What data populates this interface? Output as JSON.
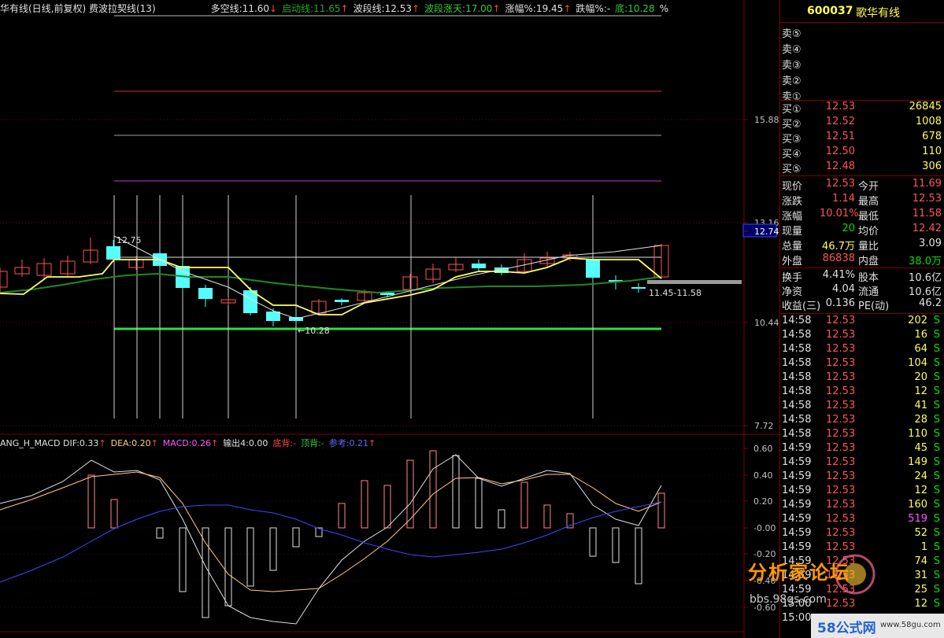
{
  "header": {
    "title": "华有线(日线,前复权) 费波拉契线(13)",
    "items": [
      {
        "label": "多空线:11.60",
        "arrow": "↓",
        "color": "#e0e0e0"
      },
      {
        "label": "启动线:11.65",
        "arrow": "↑",
        "color": "#22aa22"
      },
      {
        "label": "波段线:12.53",
        "arrow": "↑",
        "color": "#e0e0e0"
      },
      {
        "label": "波段涨天:17.00",
        "arrow": "↑",
        "color": "#33cc33"
      },
      {
        "label": "涨幅%:19.45",
        "arrow": "↑",
        "color": "#e0e0e0"
      },
      {
        "label": "跌幅%:-",
        "arrow": "",
        "color": "#e0e0e0"
      },
      {
        "label": "底:10.28",
        "arrow": "",
        "color": "#33cc33"
      },
      {
        "label": "%",
        "arrow": "",
        "color": "#e0e0e0"
      }
    ]
  },
  "price_axis": [
    "15.88",
    "13.16",
    "12.74",
    "10.44",
    "7.72"
  ],
  "annotations": {
    "high": "12.75",
    "low": "10.28",
    "range": "11.45-11.58"
  },
  "macd_header": [
    {
      "label": "ANG_H_MACD DIF:0.33",
      "arrow": "↑",
      "color": "#e0e0e0"
    },
    {
      "label": "DEA:0.20",
      "arrow": "↑",
      "color": "#ffcc88"
    },
    {
      "label": "MACD:0.26",
      "arrow": "↑",
      "color": "#ff55ff"
    },
    {
      "label": "输出4:0.00",
      "arrow": "",
      "color": "#e0e0e0"
    },
    {
      "label": "底背:-",
      "arrow": "",
      "color": "#ff4444"
    },
    {
      "label": "顶背:-",
      "arrow": "",
      "color": "#33cc33"
    },
    {
      "label": "参考:0.21",
      "arrow": "↑",
      "color": "#6666ff"
    }
  ],
  "macd_axis": [
    "0.60",
    "0.40",
    "0.20",
    "-0.00",
    "-0.20",
    "-0.40",
    "-0.60"
  ],
  "panel": {
    "code": "600037",
    "name": "歌华有线",
    "sells": [
      "卖⑤",
      "卖④",
      "卖③",
      "卖②",
      "卖①"
    ],
    "buys": [
      {
        "label": "买①",
        "price": "12.53",
        "vol": "26845"
      },
      {
        "label": "买②",
        "price": "12.52",
        "vol": "1008"
      },
      {
        "label": "买③",
        "price": "12.51",
        "vol": "678"
      },
      {
        "label": "买④",
        "price": "12.50",
        "vol": "110"
      },
      {
        "label": "买⑤",
        "price": "12.48",
        "vol": "306"
      }
    ],
    "quote": [
      {
        "l1": "现价",
        "v1": "12.53",
        "c1": "red",
        "l2": "今开",
        "v2": "11.69",
        "c2": "red"
      },
      {
        "l1": "涨跌",
        "v1": "1.14",
        "c1": "red",
        "l2": "最高",
        "v2": "12.53",
        "c2": "red"
      },
      {
        "l1": "涨幅",
        "v1": "10.01%",
        "c1": "red",
        "l2": "最低",
        "v2": "11.58",
        "c2": "red"
      },
      {
        "l1": "现量",
        "v1": "20",
        "c1": "grn",
        "l2": "均价",
        "v2": "12.42",
        "c2": "red"
      },
      {
        "l1": "总量",
        "v1": "46.7万",
        "c1": "yel",
        "l2": "量比",
        "v2": "3.09",
        "c2": "wht"
      },
      {
        "l1": "外盘",
        "v1": "86838",
        "c1": "red",
        "l2": "内盘",
        "v2": "38.0万",
        "c2": "grn"
      }
    ],
    "finance": [
      {
        "l1": "换手",
        "v1": "4.41%",
        "l2": "股本",
        "v2": "10.6亿"
      },
      {
        "l1": "净资",
        "v1": "4.04",
        "l2": "流通",
        "v2": "10.6亿"
      },
      {
        "l1": "收益(三)",
        "v1": "0.136",
        "l2": "PE(动)",
        "v2": "46.2"
      }
    ],
    "ticks": [
      {
        "t": "14:58",
        "p": "12.53",
        "v": "202",
        "s": "S"
      },
      {
        "t": "14:58",
        "p": "12.53",
        "v": "16",
        "s": "S"
      },
      {
        "t": "14:58",
        "p": "12.53",
        "v": "64",
        "s": "S"
      },
      {
        "t": "14:58",
        "p": "12.53",
        "v": "104",
        "s": "S"
      },
      {
        "t": "14:58",
        "p": "12.53",
        "v": "20",
        "s": "S"
      },
      {
        "t": "14:58",
        "p": "12.53",
        "v": "12",
        "s": "S"
      },
      {
        "t": "14:58",
        "p": "12.53",
        "v": "41",
        "s": "S"
      },
      {
        "t": "14:58",
        "p": "12.53",
        "v": "28",
        "s": "S"
      },
      {
        "t": "14:58",
        "p": "12.53",
        "v": "110",
        "s": "S"
      },
      {
        "t": "14:59",
        "p": "12.53",
        "v": "45",
        "s": "S"
      },
      {
        "t": "14:59",
        "p": "12.53",
        "v": "149",
        "s": "S"
      },
      {
        "t": "14:59",
        "p": "12.53",
        "v": "24",
        "s": "S"
      },
      {
        "t": "14:59",
        "p": "12.53",
        "v": "12",
        "s": "S"
      },
      {
        "t": "14:59",
        "p": "12.53",
        "v": "160",
        "s": "S"
      },
      {
        "t": "14:59",
        "p": "12.53",
        "v": "519",
        "s": "S"
      },
      {
        "t": "14:59",
        "p": "12.53",
        "v": "52",
        "s": "S"
      },
      {
        "t": "14:59",
        "p": "12.53",
        "v": "1",
        "s": "S"
      },
      {
        "t": "14:59",
        "p": "12.53",
        "v": "74",
        "s": "S"
      },
      {
        "t": "14:59",
        "p": "12.53",
        "v": "31",
        "s": "S"
      },
      {
        "t": "14:59",
        "p": "12.53",
        "v": "25",
        "s": "S"
      },
      {
        "t": "15:00",
        "p": "12.53",
        "v": "12",
        "s": "S"
      },
      {
        "t": "15:00",
        "p": "",
        "v": "",
        "s": ""
      }
    ]
  },
  "watermark": {
    "line1": "分析家论坛",
    "line2": "bbs.98gs.com",
    "site": "58公式网",
    "url": "www.58gu.com"
  }
}
